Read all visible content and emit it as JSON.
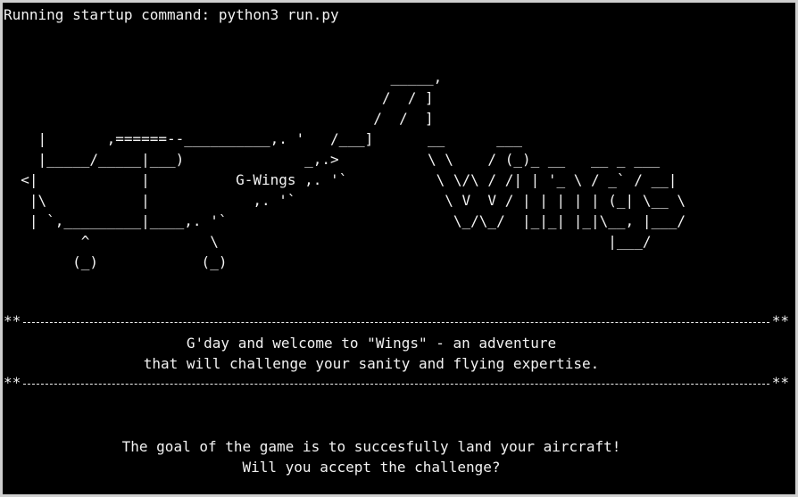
{
  "terminal": {
    "startup_line": "Running startup command: python3 run.py",
    "plane_art": "                                             _____,\n                                            /  / ]\n                                           /  /  ]\n    |       ,======--__________,. '   /___]\n    |_____/_____|___)              _,.>\n  <|            |          G-Wings ,. '`\n   |\\           |            ,. '`\n   | `,_________|____,. '`\n         ^              \\\n        (_)            (_)",
    "logo_art": "__      ___\n\\ \\    / (_)_ __   __ _ ___\n \\ \\/\\ / /| | '_ \\ / _` / __|\n  \\ V  V / | | | | | (_| \\__ \\\n   \\_/\\_/  |_|_| |_|\\__, |___/\n                     |___/",
    "divider_stars": "**",
    "welcome_line_1": "G'day and welcome to \"Wings\" - an adventure",
    "welcome_line_2": "that will challenge your sanity and flying expertise.",
    "goal_line_1": "The goal of the game is to succesfully land your aircraft!",
    "goal_line_2": "Will you accept the challenge?"
  }
}
